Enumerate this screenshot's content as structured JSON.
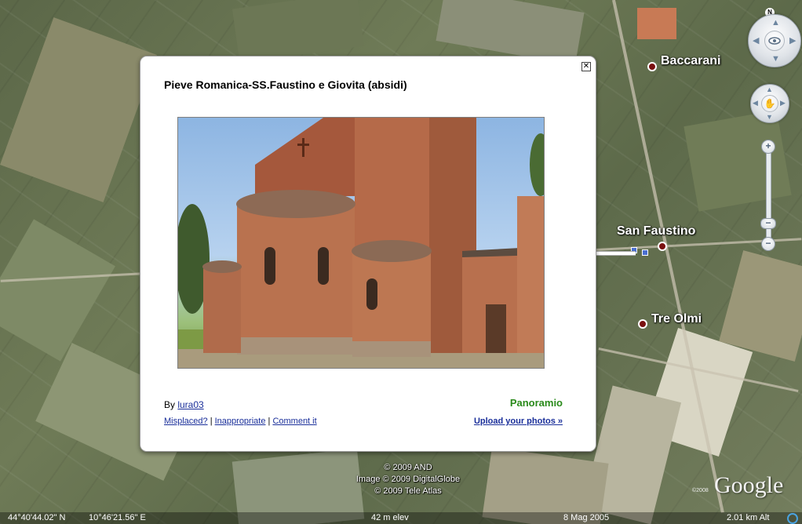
{
  "map": {
    "places": [
      {
        "name": "Baccarani"
      },
      {
        "name": "San Faustino"
      },
      {
        "name": "Tre Olmi"
      }
    ]
  },
  "navigation": {
    "north_label": "N",
    "zoom_in": "+",
    "zoom_out": "−",
    "zoom_thumb": "−",
    "zoom_level": 0.82
  },
  "balloon": {
    "title": "Pieve Romanica-SS.Faustino e Giovita (absidi)",
    "close_label": "✕",
    "by_prefix": "By ",
    "author": "lura03",
    "logo": "Panoramio",
    "links": {
      "misplaced": "Misplaced?",
      "inappropriate": "Inappropriate",
      "comment": "Comment it",
      "separator": " | "
    },
    "upload": "Upload your photos »"
  },
  "credits": {
    "line1": "© 2009 AND",
    "line2": "Image © 2009 DigitalGlobe",
    "line3": "© 2009 Tele Atlas"
  },
  "logo": {
    "text": "Google",
    "year": "©2008"
  },
  "status": {
    "latitude": "44°40'44.02\" N",
    "longitude": "10°46'21.56\" E",
    "elevation": "42 m elev",
    "date": "8 Mag 2005",
    "eye_alt": "2.01 km Alt"
  },
  "colors": {
    "link": "#1a2f9a",
    "panoramio_green": "#2a8a1b",
    "pin": "#7a1010"
  }
}
